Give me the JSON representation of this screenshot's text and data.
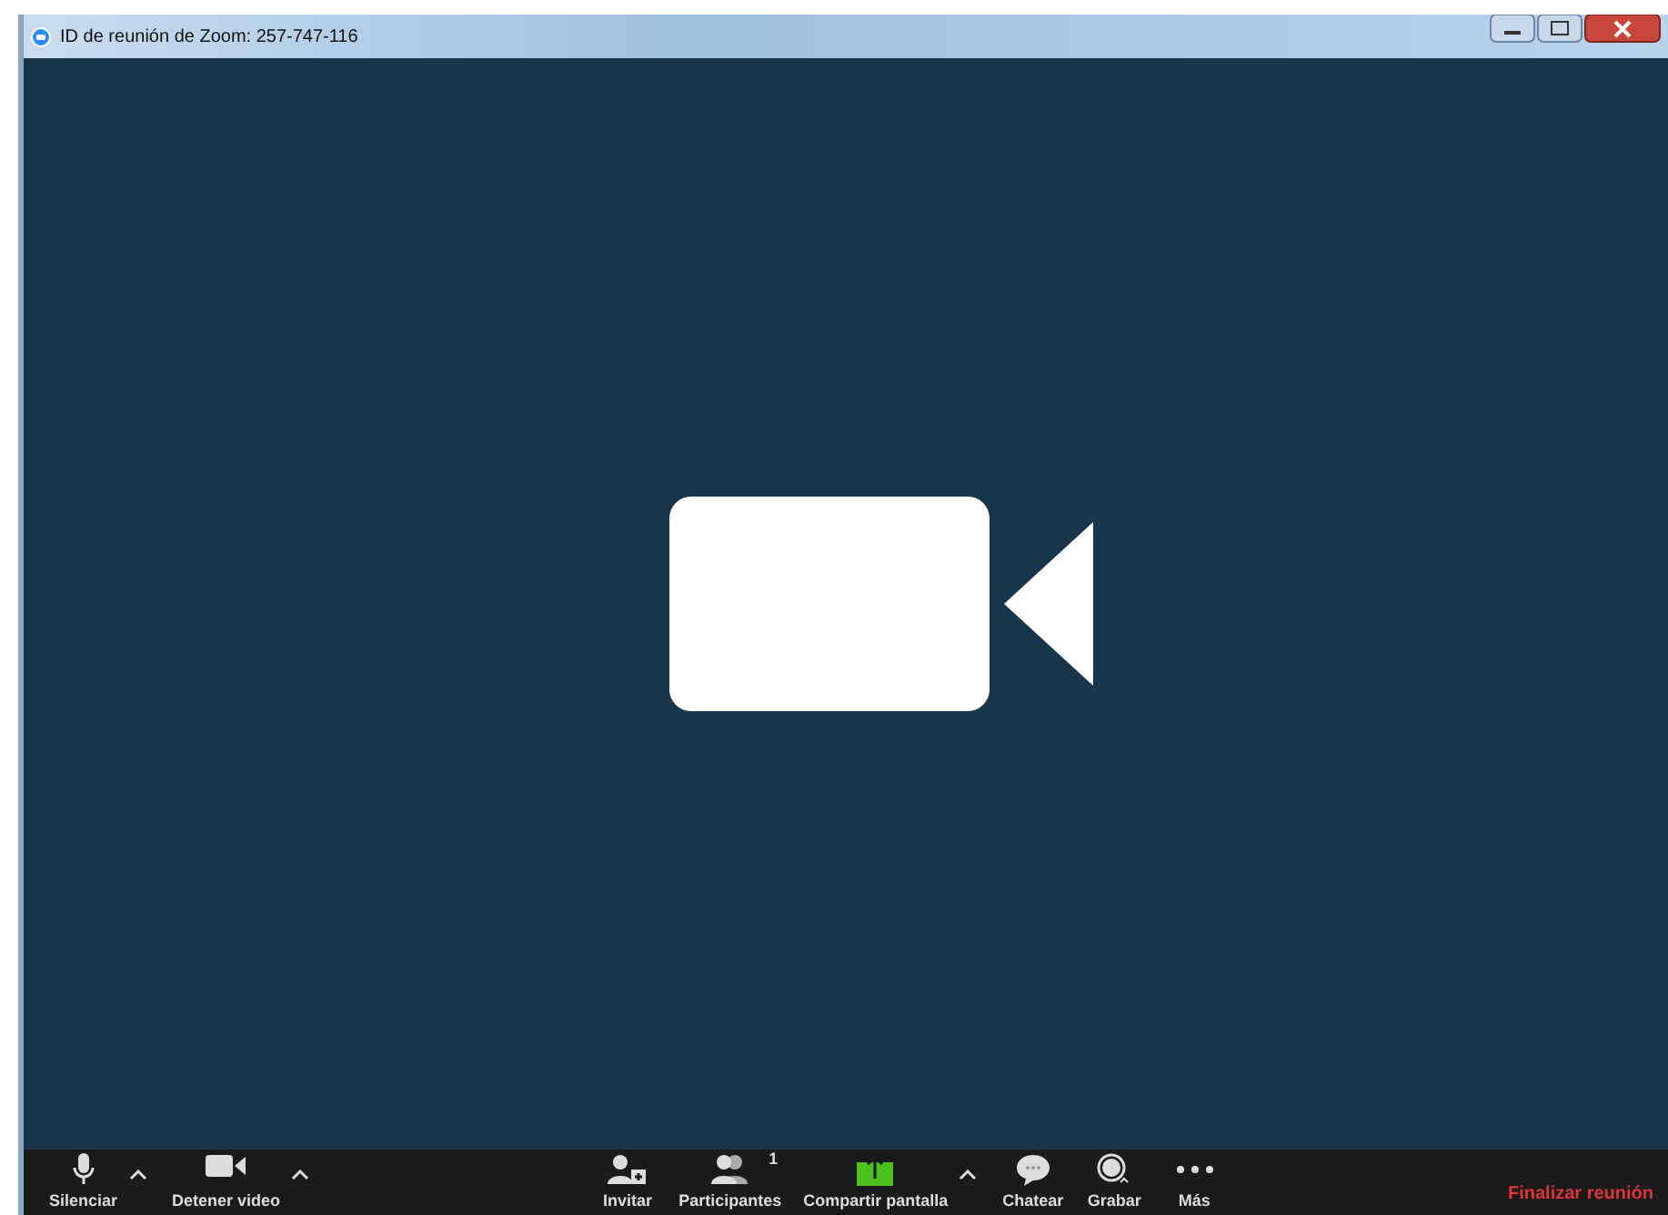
{
  "window": {
    "title": "ID de reunión de Zoom: 257-747-116"
  },
  "toolbar": {
    "left": [
      {
        "kind": "mic",
        "label": "Silenciar",
        "has_menu": true
      },
      {
        "kind": "camera",
        "label": "Detener video",
        "has_menu": true
      }
    ],
    "center": [
      {
        "kind": "invite",
        "label": "Invitar",
        "has_menu": false
      },
      {
        "kind": "participants",
        "label": "Participantes",
        "has_menu": false,
        "badge": "1"
      },
      {
        "kind": "share",
        "label": "Compartir pantalla",
        "has_menu": true
      },
      {
        "kind": "chat",
        "label": "Chatear",
        "has_menu": false
      },
      {
        "kind": "record",
        "label": "Grabar",
        "has_menu": false
      },
      {
        "kind": "more",
        "label": "Más",
        "has_menu": false
      }
    ],
    "end_button": "Finalizar reunión"
  }
}
